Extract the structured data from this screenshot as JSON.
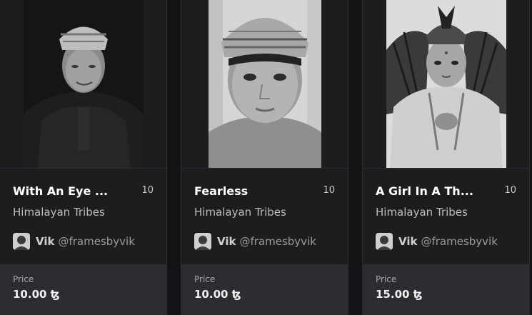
{
  "cards": [
    {
      "title": "With An Eye ...",
      "edition": "10",
      "collection": "Himalayan Tribes",
      "creator_name": "Vik",
      "creator_handle": "@framesbyvik",
      "price_label": "Price",
      "price_value": "10.00 ꜩ"
    },
    {
      "title": "Fearless",
      "edition": "10",
      "collection": "Himalayan Tribes",
      "creator_name": "Vik",
      "creator_handle": "@framesbyvik",
      "price_label": "Price",
      "price_value": "10.00 ꜩ"
    },
    {
      "title": "A Girl In A Th...",
      "edition": "10",
      "collection": "Himalayan Tribes",
      "creator_name": "Vik",
      "creator_handle": "@framesbyvik",
      "price_label": "Price",
      "price_value": "15.00 ꜩ"
    }
  ]
}
